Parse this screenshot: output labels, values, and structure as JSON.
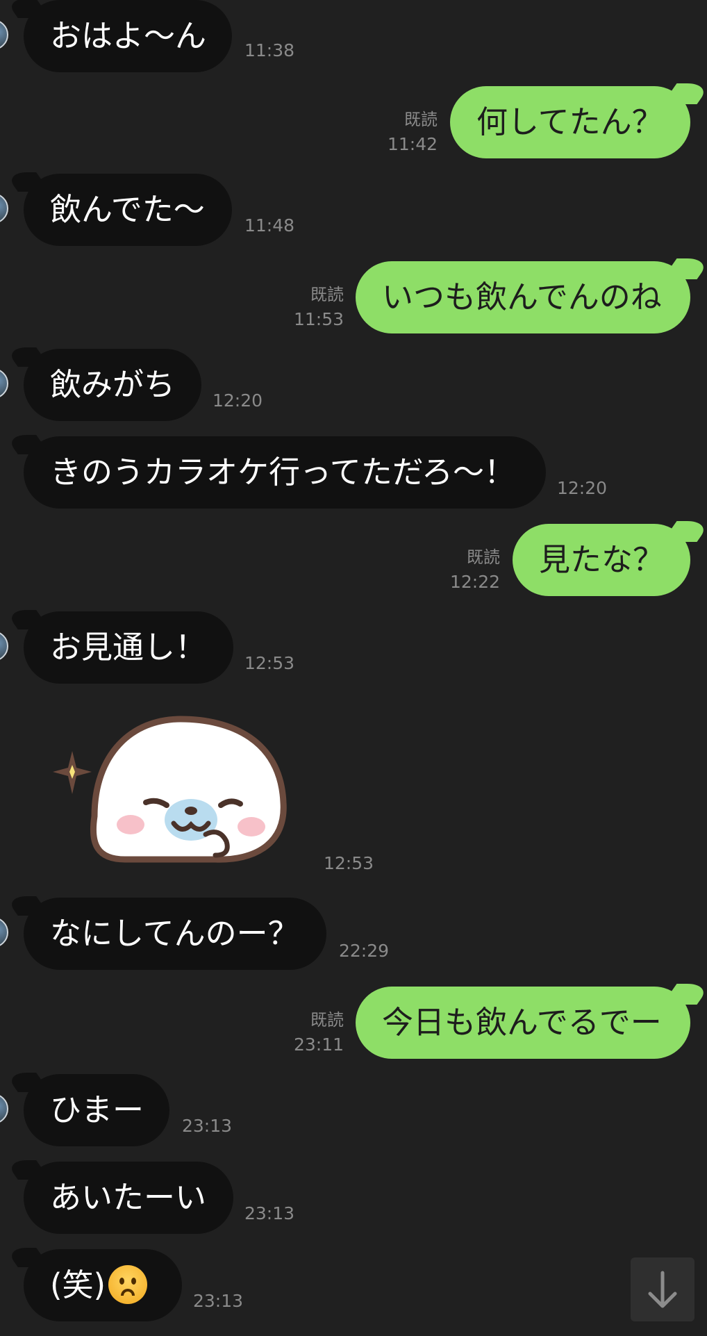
{
  "messages": [
    {
      "id": 1,
      "side": "in",
      "text": "おはよ〜ん",
      "time": "11:38"
    },
    {
      "id": 2,
      "side": "out",
      "text": "何してたん？",
      "read": "既読",
      "time": "11:42"
    },
    {
      "id": 3,
      "side": "in",
      "text": "飲んでた〜",
      "time": "11:48"
    },
    {
      "id": 4,
      "side": "out",
      "text": "いつも飲んでんのね",
      "read": "既読",
      "time": "11:53"
    },
    {
      "id": 5,
      "side": "in",
      "text": "飲みがち",
      "time": "12:20"
    },
    {
      "id": 6,
      "side": "in",
      "text": "きのうカラオケ行ってただろ〜！",
      "time": "12:20"
    },
    {
      "id": 7,
      "side": "out",
      "text": "見たな？",
      "read": "既読",
      "time": "12:22"
    },
    {
      "id": 8,
      "side": "in",
      "text": "お見通し！",
      "time": "12:53"
    },
    {
      "id": 9,
      "side": "in",
      "type": "sticker",
      "sticker": "seal-sticker",
      "time": "12:53"
    },
    {
      "id": 10,
      "side": "in",
      "text": "なにしてんのー？",
      "time": "22:29"
    },
    {
      "id": 11,
      "side": "out",
      "text": "今日も飲んでるでー",
      "read": "既読",
      "time": "23:11"
    },
    {
      "id": 12,
      "side": "in",
      "text": "ひまー",
      "time": "23:13"
    },
    {
      "id": 13,
      "side": "in",
      "text": "あいたーい",
      "time": "23:13"
    },
    {
      "id": 14,
      "side": "in",
      "text": "(笑)",
      "emoji": "frowning-face-emoji",
      "time": "23:13"
    }
  ],
  "icons": {
    "scroll_down": "arrow-down-icon"
  },
  "colors": {
    "background": "#202020",
    "incoming_bubble": "#111111",
    "outgoing_bubble": "#8ede67",
    "timestamp": "#8a8a8a"
  }
}
